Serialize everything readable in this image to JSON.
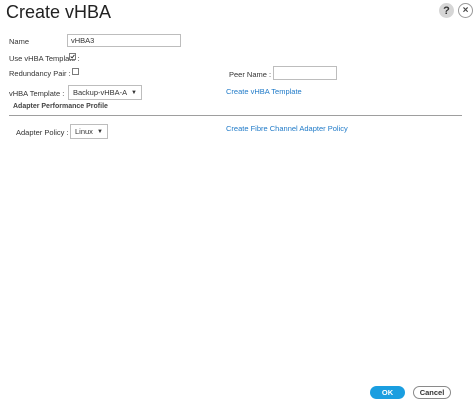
{
  "dialog": {
    "title": "Create vHBA",
    "help_icon": "?",
    "close_icon": "×"
  },
  "form": {
    "name_label": "Name",
    "name_value": "vHBA3",
    "use_template_label": "Use vHBA Template :",
    "use_template_checked": true,
    "redundancy_pair_label": "Redundancy Pair :",
    "redundancy_pair_checked": false,
    "peer_name_label": "Peer Name :",
    "peer_name_value": "",
    "vhba_template_label": "vHBA Template :",
    "vhba_template_value": "Backup-vHBA-A",
    "create_template_link": "Create vHBA Template"
  },
  "adapter": {
    "section_title": "Adapter Performance Profile",
    "policy_label": "Adapter Policy :",
    "policy_value": "Linux",
    "create_policy_link": "Create Fibre Channel Adapter Policy"
  },
  "footer": {
    "ok_label": "OK",
    "cancel_label": "Cancel"
  },
  "colors": {
    "link": "#1f7ac8",
    "primary_button": "#1a9ee0"
  },
  "icons": {
    "help": "help-icon",
    "close": "close-icon",
    "dropdown": "chevron-down-icon",
    "checkmark": "checkmark-icon"
  }
}
